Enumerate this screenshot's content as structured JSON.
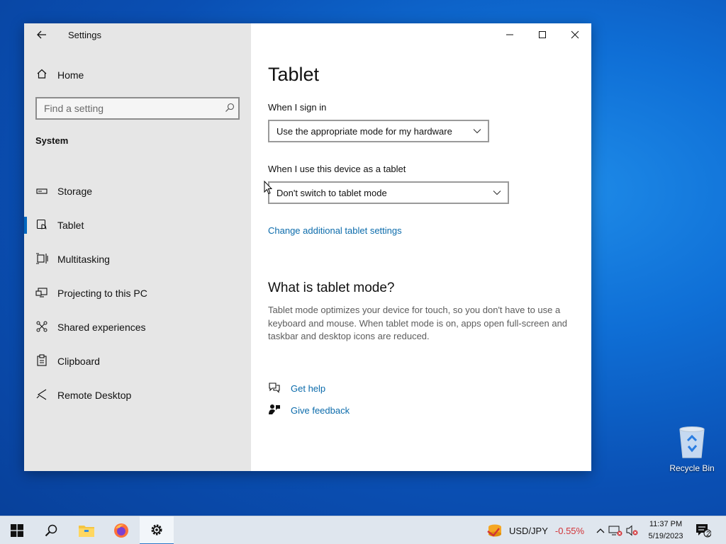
{
  "window": {
    "app_title": "Settings",
    "nav": {
      "home_label": "Home",
      "search_placeholder": "Find a setting",
      "section_title": "System",
      "items": [
        {
          "label": "Storage",
          "icon": "storage-icon"
        },
        {
          "label": "Tablet",
          "icon": "tablet-icon",
          "active": true
        },
        {
          "label": "Multitasking",
          "icon": "multitasking-icon"
        },
        {
          "label": "Projecting to this PC",
          "icon": "projecting-icon"
        },
        {
          "label": "Shared experiences",
          "icon": "shared-experiences-icon"
        },
        {
          "label": "Clipboard",
          "icon": "clipboard-icon"
        },
        {
          "label": "Remote Desktop",
          "icon": "remote-desktop-icon"
        }
      ]
    },
    "content": {
      "title": "Tablet",
      "sign_in_label": "When I sign in",
      "sign_in_value": "Use the appropriate mode for my hardware",
      "tablet_use_label": "When I use this device as a tablet",
      "tablet_use_value": "Don't switch to tablet mode",
      "additional_link": "Change additional tablet settings",
      "what_is_title": "What is tablet mode?",
      "what_is_desc": "Tablet mode optimizes your device for touch, so you don't have to use a keyboard and mouse. When tablet mode is on, apps open full-screen and taskbar and desktop icons are reduced.",
      "get_help": "Get help",
      "give_feedback": "Give feedback"
    }
  },
  "desktop": {
    "recycle_bin_label": "Recycle Bin"
  },
  "taskbar": {
    "ticker_symbol": "USD/JPY",
    "ticker_change": "-0.55%",
    "time": "11:37 PM",
    "date": "5/19/2023",
    "notification_count": "2"
  },
  "colors": {
    "accent": "#0067c0",
    "link": "#0b6bab",
    "negative": "#d13438"
  }
}
